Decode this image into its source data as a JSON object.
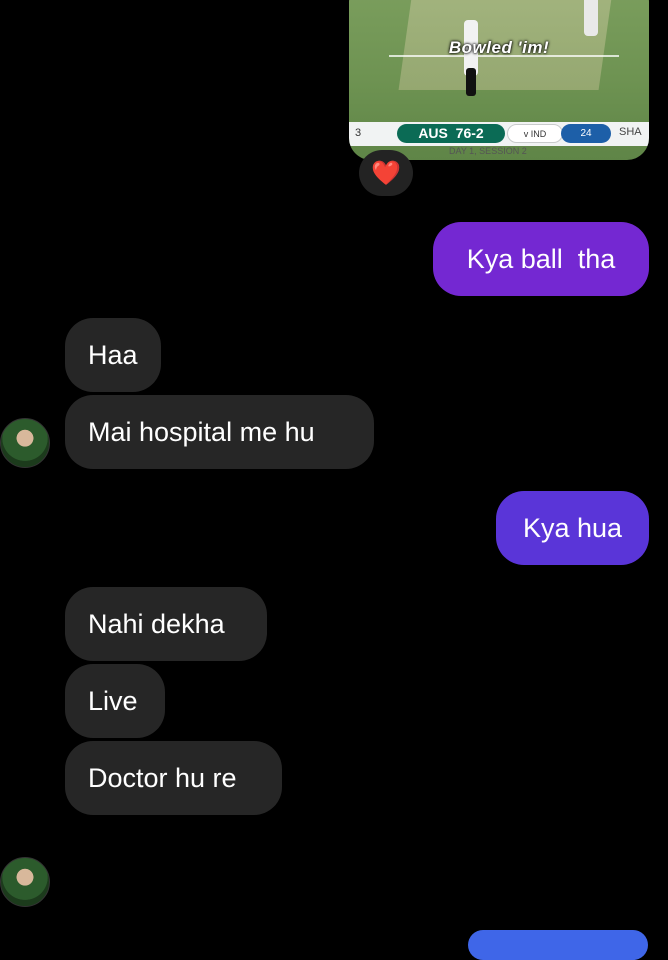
{
  "media_card": {
    "overlay_text": "Bowled 'im!",
    "score_left_number": "3",
    "score_team": "AUS",
    "score_value": "76-2",
    "score_vs": "v IND",
    "score_number": "24",
    "score_right": "SHA",
    "score_session": "DAY 1, SESSION 2"
  },
  "reaction_emoji": "❤️",
  "messages": [
    {
      "text": "Kya ball  tha"
    },
    {
      "text": "Haa"
    },
    {
      "text": "Mai hospital me hu"
    },
    {
      "text": "Kya hua"
    },
    {
      "text": "Nahi dekha"
    },
    {
      "text": "Live"
    },
    {
      "text": "Doctor hu re"
    }
  ],
  "emoji_message": "😂😂😂",
  "colors": {
    "background": "#000000",
    "received_bubble": "#262626",
    "sent_bubble_1": "#7428d2",
    "sent_bubble_2": "#5a35d8"
  }
}
